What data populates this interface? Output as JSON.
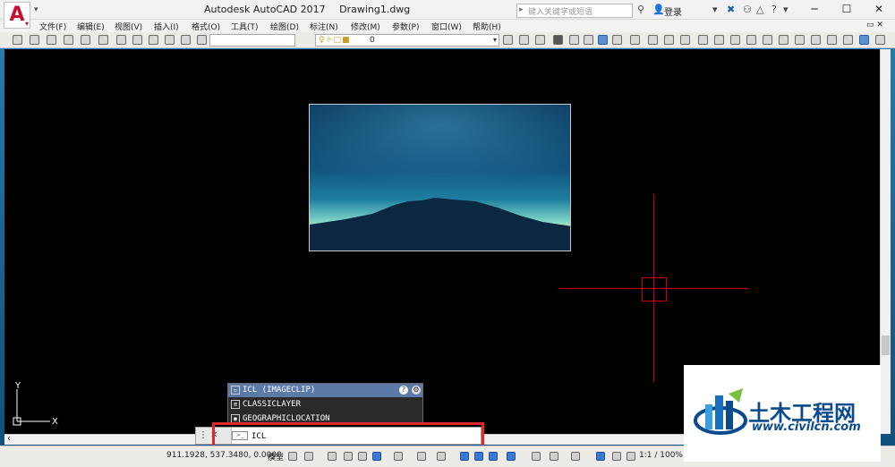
{
  "window": {
    "app_title": "Autodesk AutoCAD 2017",
    "file_name": "Drawing1.dwg",
    "search_placeholder": "键入关键字或短语",
    "login_label": "登录",
    "minimize": "─",
    "maximize": "☐",
    "close": "✕"
  },
  "menu": {
    "items": [
      "文件(F)",
      "编辑(E)",
      "视图(V)",
      "插入(I)",
      "格式(O)",
      "工具(T)",
      "绘图(D)",
      "标注(N)",
      "修改(M)",
      "参数(P)",
      "窗口(W)",
      "帮助(H)"
    ]
  },
  "toolbar": {
    "layer_value": "0"
  },
  "autocomplete": {
    "items": [
      "ICL (IMAGECLIP)",
      "CLASSICLAYER",
      "GEOGRAPHICLOCATION"
    ]
  },
  "command": {
    "input_value": "ICL"
  },
  "statusbar": {
    "coordinates": "911.1928, 537.3480, 0.0000",
    "model_label": "模型",
    "scale": "1:1 / 100%"
  },
  "watermark": {
    "title": "土木工程网",
    "url": "www.civilcn.com"
  },
  "colors": {
    "crosshair": "#cc0000",
    "highlight": "#e0282c",
    "canvas": "#000000",
    "selected_item": "#5b7aa8"
  }
}
